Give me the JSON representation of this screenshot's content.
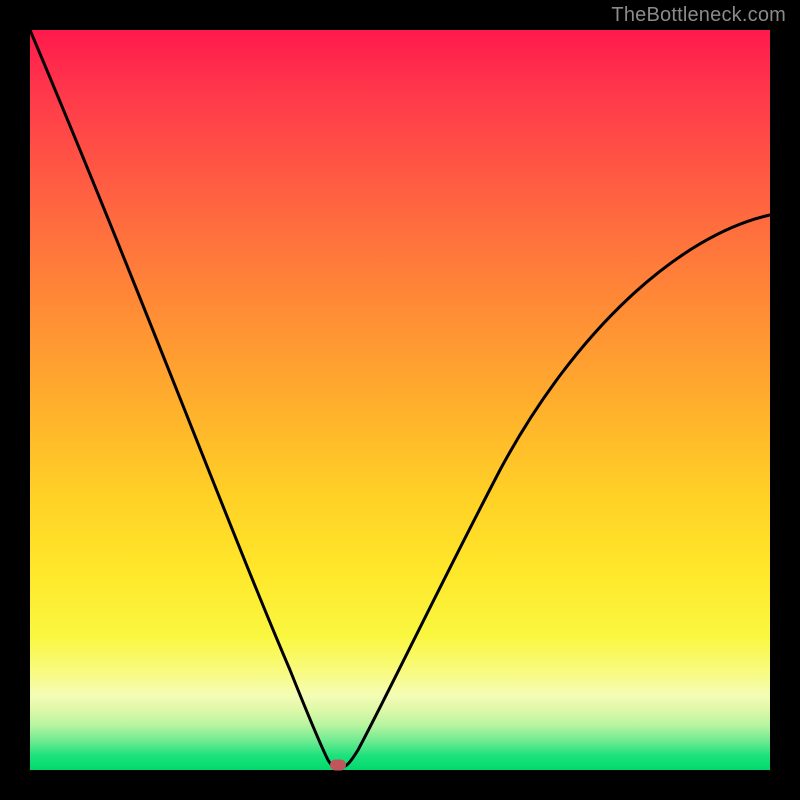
{
  "watermark": "TheBottleneck.com",
  "chart_data": {
    "type": "line",
    "title": "",
    "xlabel": "",
    "ylabel": "",
    "xlim": [
      0,
      100
    ],
    "ylim": [
      0,
      100
    ],
    "x": [
      0,
      5,
      10,
      15,
      20,
      25,
      30,
      33,
      36,
      38,
      40,
      41,
      43,
      45,
      50,
      55,
      60,
      65,
      70,
      75,
      80,
      85,
      90,
      95,
      100
    ],
    "y": [
      100,
      86,
      73,
      60,
      47,
      34,
      21,
      13,
      6,
      2,
      0,
      0,
      1,
      3,
      9,
      16,
      25,
      33,
      41,
      49,
      56,
      62,
      67,
      71,
      75
    ],
    "marker": {
      "x": 41,
      "y": 0
    },
    "background_gradient": {
      "top_color": "#ff1a4d",
      "mid_color": "#ffd126",
      "bottom_color": "#00d96d"
    }
  }
}
